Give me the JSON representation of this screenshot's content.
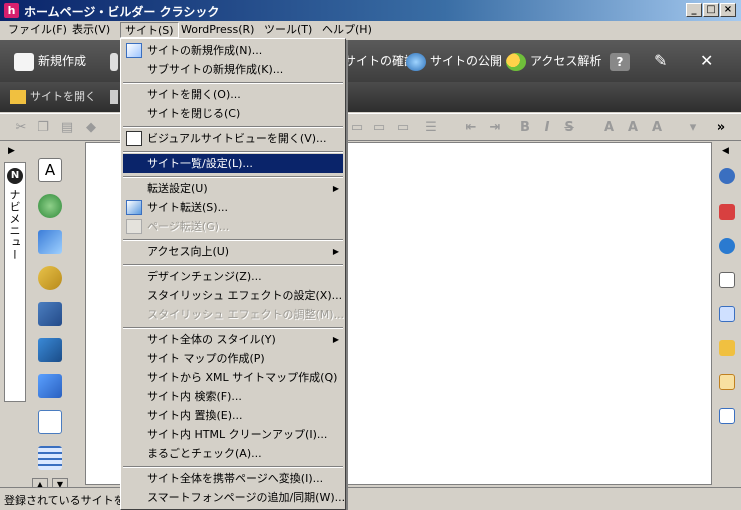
{
  "window": {
    "title": "ホームページ・ビルダー クラシック",
    "app_icon": "h",
    "buttons": [
      "_",
      "□",
      "×"
    ]
  },
  "menubar": [
    {
      "label": "ファイル(F)"
    },
    {
      "label": "表示(V)"
    },
    {
      "label": "サイト(S)"
    },
    {
      "label": "WordPress(R)"
    },
    {
      "label": "ツール(T)"
    },
    {
      "label": "ヘルプ(H)"
    }
  ],
  "darkbar": {
    "new": "新規作成",
    "site_check": "サイトの確認",
    "site_publish": "サイトの公開",
    "access": "アクセス解析"
  },
  "subbar": {
    "open_site": "サイトを開く"
  },
  "format_toolbar": {
    "bold": "B",
    "italic": "I",
    "strike": "S"
  },
  "navi": {
    "logo": "N",
    "label": "ナビメニュー"
  },
  "status": "登録されているサイトを一",
  "site_menu": {
    "items": [
      {
        "label": "サイトの新規作成(N)..."
      },
      {
        "label": "サブサイトの新規作成(K)..."
      },
      {
        "label": "サイトを開く(O)..."
      },
      {
        "label": "サイトを閉じる(C)"
      },
      {
        "label": "ビジュアルサイトビューを開く(V)..."
      },
      {
        "label": "サイト一覧/設定(L)..."
      },
      {
        "label": "転送設定(U)"
      },
      {
        "label": "サイト転送(S)..."
      },
      {
        "label": "ページ転送(G)..."
      },
      {
        "label": "アクセス向上(U)"
      },
      {
        "label": "デザインチェンジ(Z)..."
      },
      {
        "label": "スタイリッシュ エフェクトの設定(X)..."
      },
      {
        "label": "スタイリッシュ エフェクトの調整(M)..."
      },
      {
        "label": "サイト全体の スタイル(Y)"
      },
      {
        "label": "サイト マップの作成(P)"
      },
      {
        "label": "サイトから XML サイトマップ作成(Q)"
      },
      {
        "label": "サイト内 検索(F)..."
      },
      {
        "label": "サイト内 置換(E)..."
      },
      {
        "label": "サイト内 HTML クリーンアップ(I)..."
      },
      {
        "label": "まるごとチェック(A)..."
      },
      {
        "label": "サイト全体を携帯ページへ変換(I)..."
      },
      {
        "label": "スマートフォンページの追加/同期(W)..."
      }
    ]
  }
}
